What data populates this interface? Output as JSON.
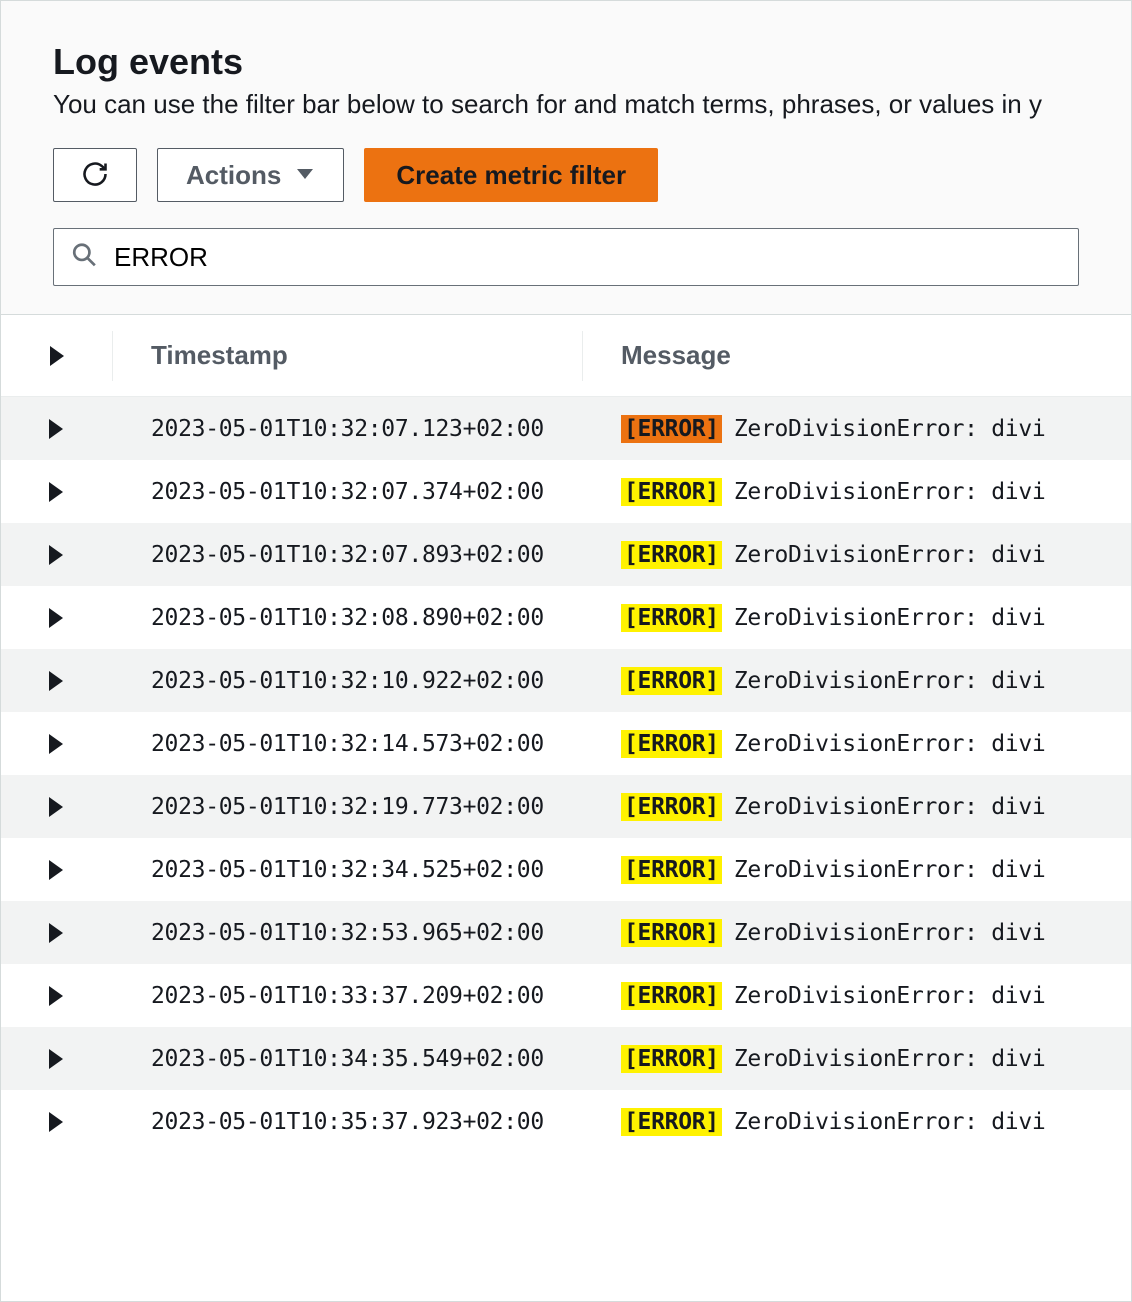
{
  "header": {
    "title": "Log events",
    "subtitle": "You can use the filter bar below to search for and match terms, phrases, or values in y"
  },
  "toolbar": {
    "actions_label": "Actions",
    "create_label": "Create metric filter"
  },
  "search": {
    "value": "ERROR"
  },
  "table": {
    "headers": {
      "timestamp": "Timestamp",
      "message": "Message"
    },
    "error_tag": "[ERROR]",
    "rows": [
      {
        "timestamp": "2023-05-01T10:32:07.123+02:00",
        "message": "ZeroDivisionError: divi",
        "highlight": "orange"
      },
      {
        "timestamp": "2023-05-01T10:32:07.374+02:00",
        "message": "ZeroDivisionError: divi",
        "highlight": "yellow"
      },
      {
        "timestamp": "2023-05-01T10:32:07.893+02:00",
        "message": "ZeroDivisionError: divi",
        "highlight": "yellow"
      },
      {
        "timestamp": "2023-05-01T10:32:08.890+02:00",
        "message": "ZeroDivisionError: divi",
        "highlight": "yellow"
      },
      {
        "timestamp": "2023-05-01T10:32:10.922+02:00",
        "message": "ZeroDivisionError: divi",
        "highlight": "yellow"
      },
      {
        "timestamp": "2023-05-01T10:32:14.573+02:00",
        "message": "ZeroDivisionError: divi",
        "highlight": "yellow"
      },
      {
        "timestamp": "2023-05-01T10:32:19.773+02:00",
        "message": "ZeroDivisionError: divi",
        "highlight": "yellow"
      },
      {
        "timestamp": "2023-05-01T10:32:34.525+02:00",
        "message": "ZeroDivisionError: divi",
        "highlight": "yellow"
      },
      {
        "timestamp": "2023-05-01T10:32:53.965+02:00",
        "message": "ZeroDivisionError: divi",
        "highlight": "yellow"
      },
      {
        "timestamp": "2023-05-01T10:33:37.209+02:00",
        "message": "ZeroDivisionError: divi",
        "highlight": "yellow"
      },
      {
        "timestamp": "2023-05-01T10:34:35.549+02:00",
        "message": "ZeroDivisionError: divi",
        "highlight": "yellow"
      },
      {
        "timestamp": "2023-05-01T10:35:37.923+02:00",
        "message": "ZeroDivisionError: divi",
        "highlight": "yellow"
      }
    ]
  }
}
